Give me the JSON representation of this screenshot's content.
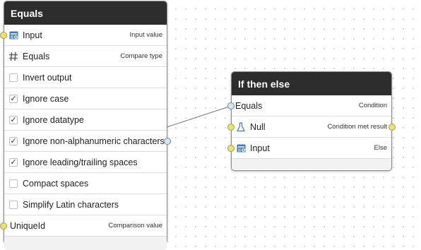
{
  "equals_node": {
    "title": "Equals",
    "rows": [
      {
        "label": "Input",
        "hint": "Input value"
      },
      {
        "label": "Equals",
        "hint": "Compare type"
      },
      {
        "label": "Invert output",
        "checked": false
      },
      {
        "label": "Ignore case",
        "checked": true
      },
      {
        "label": "Ignore datatype",
        "checked": true
      },
      {
        "label": "Ignore non-alphanumeric characters",
        "checked": true
      },
      {
        "label": "Ignore leading/trailing spaces",
        "checked": true
      },
      {
        "label": "Compact spaces",
        "checked": false
      },
      {
        "label": "Simplify Latin characters",
        "checked": false
      },
      {
        "label": "UniqueId",
        "hint": "Comparison value"
      }
    ],
    "check_mark": "✓"
  },
  "ifelse_node": {
    "title": "If then else",
    "rows": [
      {
        "label": "Equals",
        "hint": "Condition"
      },
      {
        "label": "Null",
        "hint": "Condition met result"
      },
      {
        "label": "Input",
        "hint": "Else"
      }
    ]
  },
  "colors": {
    "header_bg": "#2d2d2d",
    "port_yellow": "#f0e25a",
    "port_blue": "#d8e6f2",
    "icon_blue": "#3a78c2"
  },
  "icons": {
    "input": "table-input-icon",
    "equals": "hash-icon",
    "null": "flask-icon"
  }
}
